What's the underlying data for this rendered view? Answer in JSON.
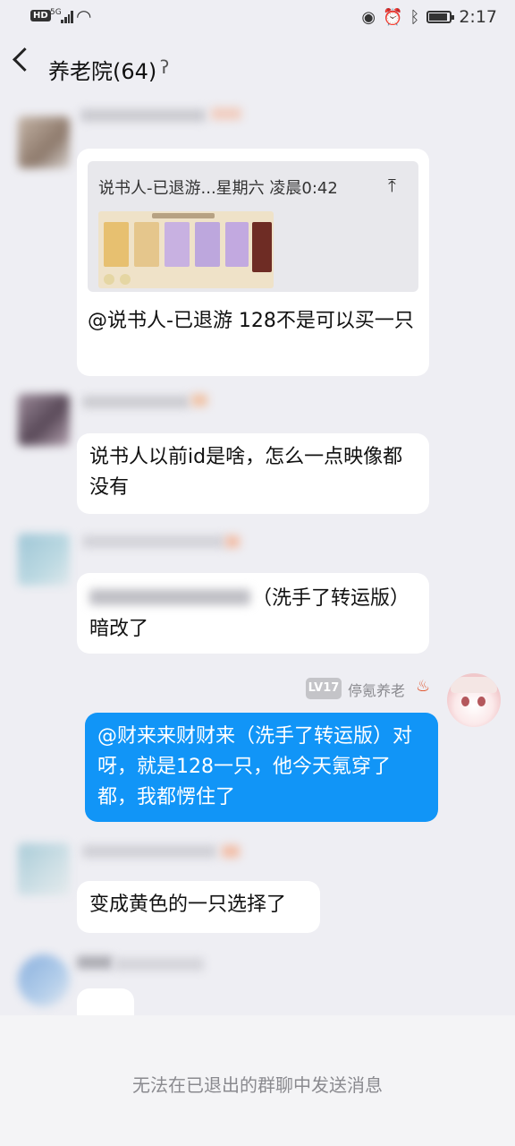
{
  "status_bar": {
    "hd": "HD",
    "network": "5G",
    "time": "2:17",
    "battery_level": 0.9,
    "icons": [
      "eye-icon",
      "alarm-icon",
      "bluetooth-icon",
      "battery-icon"
    ]
  },
  "header": {
    "title": "养老院(64)",
    "ear_icon": "ear-icon"
  },
  "messages": [
    {
      "quote": {
        "header": "说书人-已退游...星期六 凌晨0:42",
        "pin_icon": "arrow-up-icon"
      },
      "text": "@说书人-已退游 128不是可以买一只"
    },
    {
      "text": "说书人以前id是啥，怎么一点映像都没有"
    },
    {
      "text_visible": "（洗手了转运版）",
      "text2": "暗改了"
    },
    {
      "sender": {
        "level": "LV17",
        "name": "停氪养老"
      },
      "text": "@财来来财财来（洗手了转运版）对呀，就是128一只，他今天氪穿了都，我都愣住了"
    },
    {
      "text": "变成黄色的一只选择了"
    }
  ],
  "footer": {
    "notice": "无法在已退出的群聊中发送消息"
  },
  "colors": {
    "background": "#eeeef3",
    "my_bubble": "#1195f7",
    "other_bubble": "#ffffff",
    "level_badge": "#c4c4c8"
  }
}
